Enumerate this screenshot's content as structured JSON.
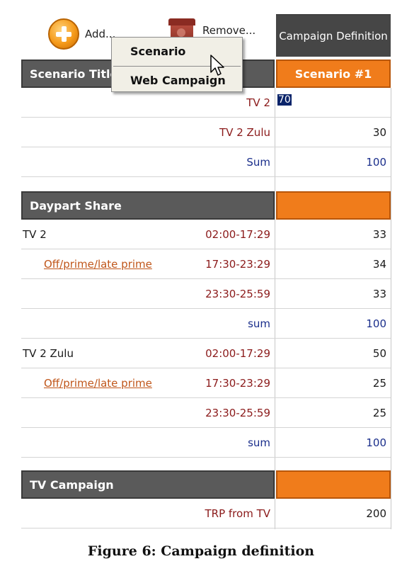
{
  "toolbar": {
    "add_label": "Add...",
    "remove_label": "Remove...",
    "campaign_definition": "Campaign Definition"
  },
  "popup_menu": {
    "items": [
      "Scenario",
      "Web Campaign"
    ]
  },
  "scenario": {
    "title_header": "Scenario Title",
    "column_header": "Scenario #1",
    "rows": [
      {
        "label": "TV 2",
        "value": "70"
      },
      {
        "label": "TV 2 Zulu",
        "value": "30"
      },
      {
        "label": "Sum",
        "value": "100"
      }
    ]
  },
  "daypart": {
    "header": "Daypart Share",
    "groups": [
      {
        "channel": "TV 2",
        "link": "Off/prime/late prime",
        "rows": [
          {
            "time": "02:00-17:29",
            "value": "33"
          },
          {
            "time": "17:30-23:29",
            "value": "34"
          },
          {
            "time": "23:30-25:59",
            "value": "33"
          }
        ],
        "sum_label": "sum",
        "sum_value": "100"
      },
      {
        "channel": "TV 2 Zulu",
        "link": "Off/prime/late prime",
        "rows": [
          {
            "time": "02:00-17:29",
            "value": "50"
          },
          {
            "time": "17:30-23:29",
            "value": "25"
          },
          {
            "time": "23:30-25:59",
            "value": "25"
          }
        ],
        "sum_label": "sum",
        "sum_value": "100"
      }
    ]
  },
  "tv_campaign": {
    "header": "TV Campaign",
    "row_label": "TRP from TV",
    "row_value": "200"
  },
  "caption": "Figure 6: Campaign definition"
}
